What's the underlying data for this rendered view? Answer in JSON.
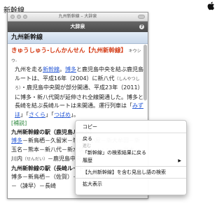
{
  "caption": "新幹線",
  "window": {
    "title": "九州新幹線 – 大辞泉",
    "dict_name": "大辞泉",
    "dict_knob": "?",
    "heading": "九州新幹線"
  },
  "entry": {
    "headword": "きゅうしゅう-しんかんせん【九州新幹線】",
    "headword_reading": "キウシウ-",
    "p1": [
      {
        "t": "九州を走る"
      },
      {
        "t": "新幹線",
        "link": true
      },
      {
        "t": "。"
      },
      {
        "t": "博多",
        "link": true
      },
      {
        "t": "と鹿児島中央を結ぶ鹿児島ルートは、平成16年（2004）に新八代"
      },
      {
        "t": "（しんやつしろ）",
        "small": true
      },
      {
        "t": "・鹿児島中央間が部分開通、平成23年（2011）に博多・新八代間が延伸され全線開通した。博多と長崎を結ぶ長崎ルートは未開通。"
      },
      {
        "t": "運行列車は「"
      },
      {
        "t": "みずほ",
        "link": true
      },
      {
        "t": "」「"
      },
      {
        "t": "さくら",
        "link": true
      },
      {
        "t": "」「"
      },
      {
        "t": "つばめ",
        "link": true
      },
      {
        "t": "」。"
      }
    ],
    "supplement_tag": "[補説]",
    "station_heading_1": "九州新幹線の駅（鹿児島ルート）",
    "p2": [
      {
        "t": "博多",
        "link": true
      },
      {
        "t": "－新鳥栖－久留米－筑後船小屋－新大牟田－新玉名－熊本－新八代－新水俣"
      },
      {
        "t": "（しんみなまた）",
        "small": true
      },
      {
        "t": "－出水－川内"
      },
      {
        "t": "（せんだい）",
        "small": true
      },
      {
        "t": "－鹿児島中央"
      }
    ],
    "station_heading_2": "九州新幹線の駅（長崎ルート）",
    "p3": [
      {
        "t": "博多－新鳥栖－（佐賀）－（武雄温泉）－嬉野温泉－（諫早）－長崎"
      }
    ]
  },
  "context_menu": {
    "items": [
      {
        "label": "コピー",
        "disabled": false,
        "submenu": false
      },
      {
        "sep": true
      },
      {
        "label": "戻る",
        "disabled": false,
        "submenu": false
      },
      {
        "label": "進む",
        "disabled": true,
        "submenu": false
      },
      {
        "label": "「新幹線」の検索結果に戻る",
        "disabled": false,
        "submenu": false
      },
      {
        "label": "履歴",
        "disabled": false,
        "submenu": true
      },
      {
        "sep": true
      },
      {
        "label": "【九州新幹線】を含む見出し語の検索",
        "disabled": false,
        "submenu": false
      },
      {
        "sep": true
      },
      {
        "label": "拡大表示",
        "disabled": false,
        "submenu": false
      }
    ],
    "submenu_arrow": "▶"
  }
}
